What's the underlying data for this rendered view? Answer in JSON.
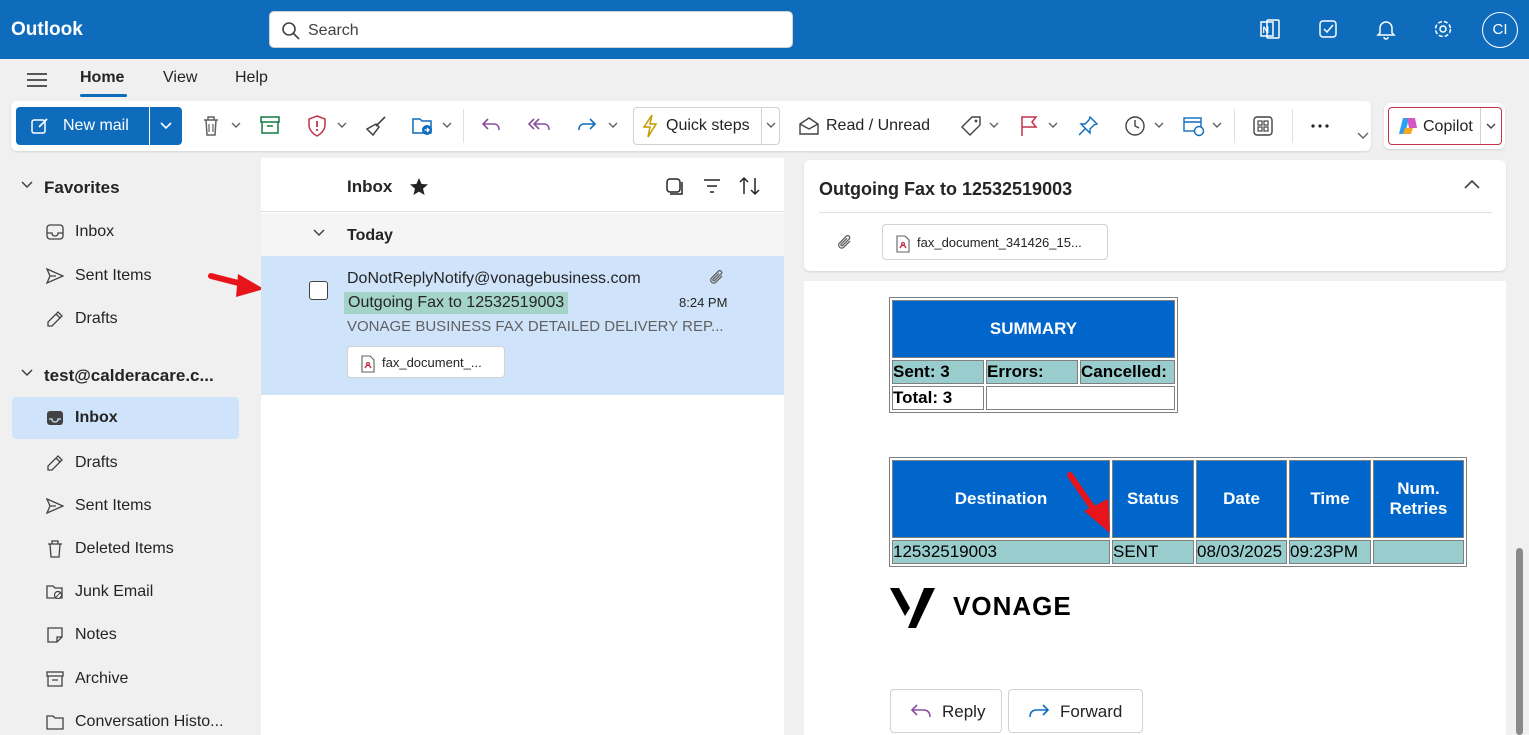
{
  "app": {
    "title": "Outlook"
  },
  "search": {
    "placeholder": "Search"
  },
  "account": {
    "initials": "CI"
  },
  "tabs": [
    {
      "label": "Home",
      "active": true
    },
    {
      "label": "View",
      "active": false
    },
    {
      "label": "Help",
      "active": false
    }
  ],
  "ribbon": {
    "new_mail": "New mail",
    "quick_steps": "Quick steps",
    "read_unread": "Read / Unread",
    "copilot": "Copilot"
  },
  "nav": {
    "favorites_label": "Favorites",
    "favorites": [
      {
        "label": "Inbox",
        "icon": "inbox-icon"
      },
      {
        "label": "Sent Items",
        "icon": "send-icon"
      },
      {
        "label": "Drafts",
        "icon": "pencil-icon"
      }
    ],
    "account_label": "test@calderacare.c...",
    "folders": [
      {
        "label": "Inbox",
        "icon": "inbox-icon",
        "selected": true
      },
      {
        "label": "Drafts",
        "icon": "pencil-icon"
      },
      {
        "label": "Sent Items",
        "icon": "send-icon"
      },
      {
        "label": "Deleted Items",
        "icon": "trash-icon"
      },
      {
        "label": "Junk Email",
        "icon": "junk-icon"
      },
      {
        "label": "Notes",
        "icon": "note-icon"
      },
      {
        "label": "Archive",
        "icon": "archive-icon"
      },
      {
        "label": "Conversation Histo...",
        "icon": "folder-icon"
      }
    ]
  },
  "list": {
    "title": "Inbox",
    "group": "Today",
    "message": {
      "from": "DoNotReplyNotify@vonagebusiness.com",
      "subject": "Outgoing Fax to 12532519003",
      "preview": "VONAGE BUSINESS FAX DETAILED DELIVERY REP...",
      "time": "8:24 PM",
      "attachment": "fax_document_..."
    }
  },
  "reading": {
    "subject": "Outgoing Fax to 12532519003",
    "attachment": "fax_document_341426_15...",
    "summary": {
      "title": "SUMMARY",
      "sent": "Sent: 3",
      "errors": "Errors:",
      "cancelled": "Cancelled:",
      "total": "Total: 3"
    },
    "detail": {
      "headers": [
        "Destination",
        "Status",
        "Date",
        "Time",
        "Num. Retries"
      ],
      "row": [
        "12532519003",
        "SENT",
        "08/03/2025",
        "09:23PM",
        ""
      ]
    },
    "brand": "VONAGE",
    "reply": "Reply",
    "forward": "Forward"
  },
  "colors": {
    "accent": "#0f6cbd",
    "selected": "#cfe4fa",
    "fax_header": "#0066cc",
    "fax_cell": "#99cccc",
    "annotation": "#e8141b"
  }
}
